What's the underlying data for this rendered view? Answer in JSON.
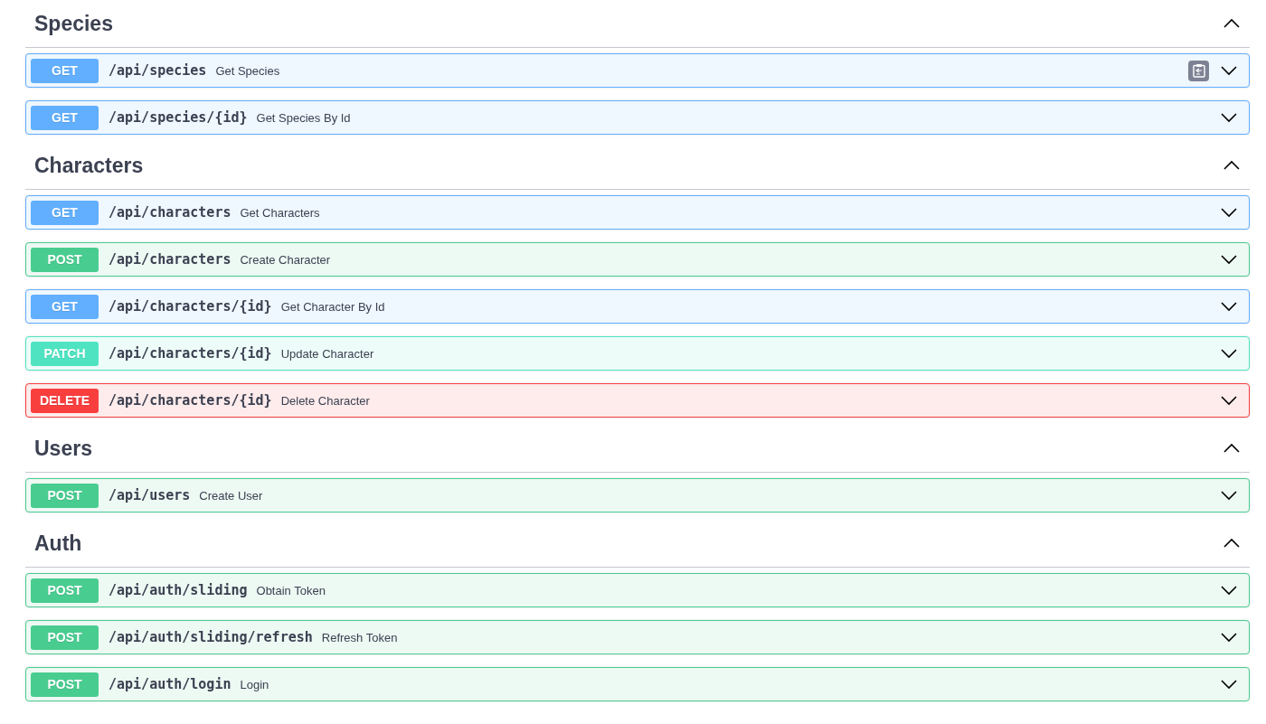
{
  "sections": [
    {
      "title": "Species",
      "expanded": true,
      "operations": [
        {
          "method": "GET",
          "kind": "get",
          "path": "/api/species",
          "summary": "Get Species",
          "hovered": true
        },
        {
          "method": "GET",
          "kind": "get",
          "path": "/api/species/{id}",
          "summary": "Get Species By Id",
          "hovered": false
        }
      ]
    },
    {
      "title": "Characters",
      "expanded": true,
      "operations": [
        {
          "method": "GET",
          "kind": "get",
          "path": "/api/characters",
          "summary": "Get Characters",
          "hovered": false
        },
        {
          "method": "POST",
          "kind": "post",
          "path": "/api/characters",
          "summary": "Create Character",
          "hovered": false
        },
        {
          "method": "GET",
          "kind": "get",
          "path": "/api/characters/{id}",
          "summary": "Get Character By Id",
          "hovered": false
        },
        {
          "method": "PATCH",
          "kind": "patch",
          "path": "/api/characters/{id}",
          "summary": "Update Character",
          "hovered": false
        },
        {
          "method": "DELETE",
          "kind": "delete",
          "path": "/api/characters/{id}",
          "summary": "Delete Character",
          "hovered": false
        }
      ]
    },
    {
      "title": "Users",
      "expanded": true,
      "operations": [
        {
          "method": "POST",
          "kind": "post",
          "path": "/api/users",
          "summary": "Create User",
          "hovered": false
        }
      ]
    },
    {
      "title": "Auth",
      "expanded": true,
      "operations": [
        {
          "method": "POST",
          "kind": "post",
          "path": "/api/auth/sliding",
          "summary": "Obtain Token",
          "hovered": false
        },
        {
          "method": "POST",
          "kind": "post",
          "path": "/api/auth/sliding/refresh",
          "summary": "Refresh Token",
          "hovered": false
        },
        {
          "method": "POST",
          "kind": "post",
          "path": "/api/auth/login",
          "summary": "Login",
          "hovered": false
        }
      ]
    }
  ]
}
